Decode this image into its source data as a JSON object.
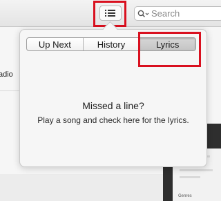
{
  "toolbar": {
    "queue_button_icon": "list-icon",
    "search": {
      "placeholder": "Search",
      "icon": "search-icon"
    }
  },
  "background": {
    "sidebar_partial_text": "adio",
    "mini_panel_label": "Genres"
  },
  "popover": {
    "tabs": [
      {
        "label": "Up Next",
        "selected": false
      },
      {
        "label": "History",
        "selected": false
      },
      {
        "label": "Lyrics",
        "selected": true
      }
    ],
    "empty_title": "Missed a line?",
    "empty_subtitle": "Play a song and check here for the lyrics."
  },
  "colors": {
    "highlight_box": "#d9101f",
    "popover_bg": "#f6f6f6",
    "toolbar_bg": "#e9e9e9"
  }
}
